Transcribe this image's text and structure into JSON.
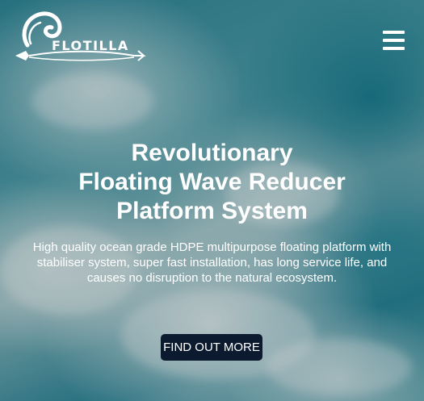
{
  "header": {
    "logo_text": "FLOTILLA",
    "logo_icon": "wave-icon",
    "menu_icon": "hamburger-menu-icon"
  },
  "hero": {
    "title_lines": [
      "Revolutionary",
      "Floating Wave Reducer",
      "Platform System"
    ],
    "subtitle": "High quality ocean grade HDPE multipurpose floating platform with stabiliser system, super fast installation, has long service life, and causes no disruption to the natural ecosystem.",
    "cta_label": "FIND OUT MORE"
  },
  "colors": {
    "text": "#ffffff",
    "cta_background": "#0b1a2e",
    "ocean": "#2f8595"
  }
}
